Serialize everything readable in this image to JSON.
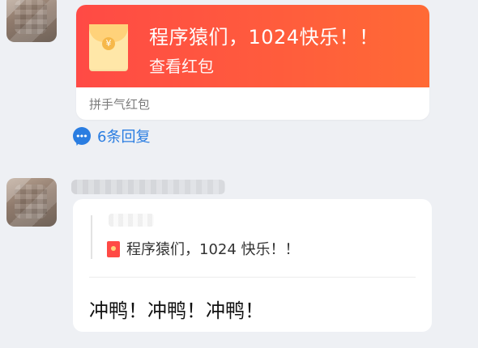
{
  "red_packet": {
    "title": "程序猿们，1024快乐！！",
    "action": "查看红包",
    "footer": "拼手气红包",
    "seal_symbol": "¥"
  },
  "replies": {
    "label": "6条回复"
  },
  "reply": {
    "quote_text": "程序猿们，1024 快乐！！",
    "text": "冲鸭！冲鸭！冲鸭！"
  },
  "colors": {
    "red_packet_gradient_start": "#ff4a45",
    "red_packet_gradient_end": "#ff6a35",
    "link_blue": "#2a7de1",
    "background": "#eef0f4"
  }
}
